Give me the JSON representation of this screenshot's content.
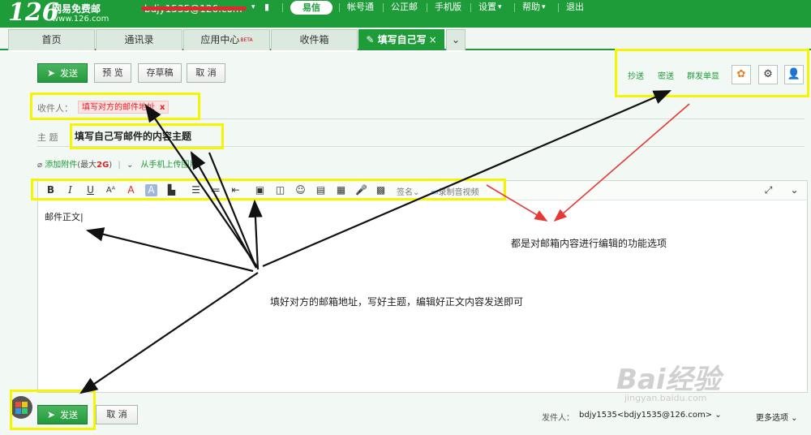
{
  "brand": {
    "logo": "126",
    "name": "网易免费邮",
    "url": "www.126.com"
  },
  "header": {
    "user": "bdjy1535@126.com",
    "yixin": "易信",
    "links": [
      "帐号通",
      "公正邮",
      "手机版",
      "设置",
      "帮助",
      "退出"
    ]
  },
  "tabs": [
    {
      "label": "首页"
    },
    {
      "label": "通讯录"
    },
    {
      "label": "应用中心",
      "badge": "BETA"
    },
    {
      "label": "收件箱"
    },
    {
      "label": "填写自己写"
    }
  ],
  "toolbar": {
    "send": "发送",
    "preview": "预 览",
    "draft": "存草稿",
    "cancel": "取 消"
  },
  "right_options": {
    "cc": "抄送",
    "bcc": "密送",
    "separate": "群发单显"
  },
  "compose": {
    "recipient_label": "收件人：",
    "recipient_chip": "填写对方的邮件地址",
    "chip_remove": "x",
    "subject_label": "主 题",
    "subject_value": "填写自己写邮件的内容主题",
    "attach_label": "添加附件",
    "attach_limit_prefix": "(最大",
    "attach_limit": "2G",
    "attach_limit_suffix": ")",
    "upload_phone": "从手机上传图片",
    "body": "邮件正文"
  },
  "editor_toolbar": {
    "signature": "签名",
    "record": "录制音视频"
  },
  "annotations": {
    "functions": "都是对邮箱内容进行编辑的功能选项",
    "instructions": "填好对方的邮箱地址，写好主题，编辑好正文内容发送即可"
  },
  "footer": {
    "send": "发送",
    "cancel": "取 消",
    "from_label": "发件人：",
    "from_value": "bdjy1535<bdjy1535@126.com>",
    "more": "更多选项"
  },
  "watermark": {
    "logo": "Bai经验",
    "url": "jingyan.baidu.com"
  },
  "colors": {
    "brand_green": "#1e9c3a",
    "highlight_yellow": "#f5f500",
    "arrow_red": "#e53935"
  }
}
